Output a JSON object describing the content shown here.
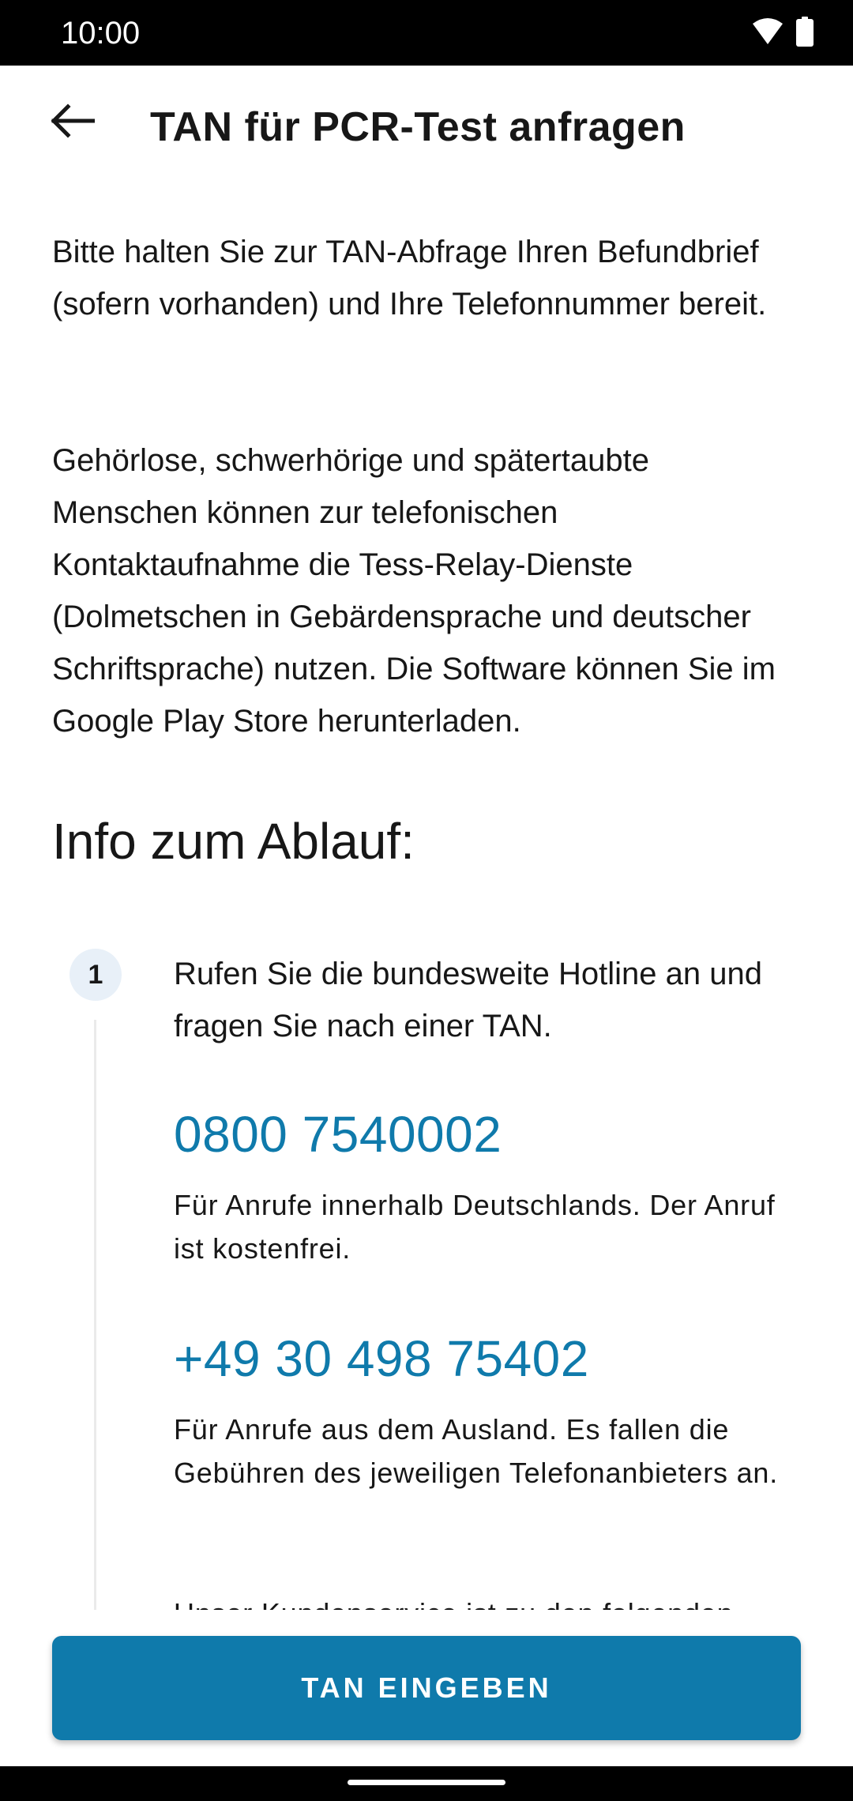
{
  "status_bar": {
    "time": "10:00",
    "icons": [
      "wifi-icon",
      "battery-icon"
    ]
  },
  "app_bar": {
    "back_icon": "arrow-back-icon",
    "title": "TAN für PCR-Test anfragen"
  },
  "content": {
    "intro": "Bitte halten Sie zur TAN-Abfrage Ihren Befundbrief (sofern vorhanden) und Ihre Telefonnummer bereit.",
    "accessibility_info": "Gehörlose, schwerhörige und spätertaubte Menschen können zur telefonischen Kontaktaufnahme die Tess-Relay-Dienste (Dolmetschen in Gebärdensprache und deutscher Schriftsprache) nutzen. Die Software können Sie im Google Play Store herunterladen.",
    "process_heading": "Info zum Ablauf:",
    "steps": [
      {
        "number": "1",
        "text": "Rufen Sie die bundesweite Hotline an und fragen Sie nach einer TAN.",
        "phones": [
          {
            "number": "0800 7540002",
            "note": "Für Anrufe innerhalb Deutschlands. Der Anruf ist kostenfrei."
          },
          {
            "number": "+49 30 498 75402",
            "note": "Für Anrufe aus dem Ausland. Es fallen die Gebühren des jeweiligen Telefonanbieters an."
          }
        ],
        "cut_off_text": "Unser Kundenservice ist zu den folgenden"
      }
    ]
  },
  "button": {
    "label": "TAN EINGEBEN"
  },
  "colors": {
    "accent": "#0f7aab",
    "step_circle_bg": "#e8f0f8"
  }
}
